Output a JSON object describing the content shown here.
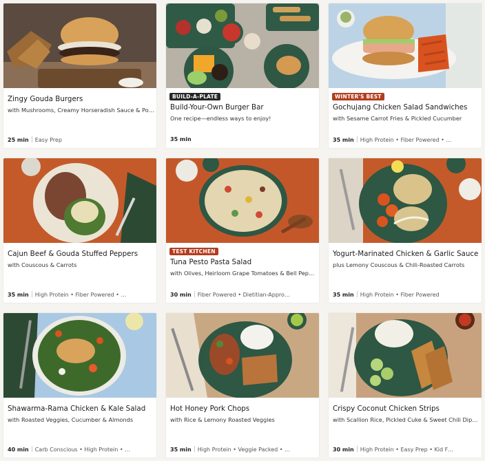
{
  "recipes": [
    {
      "title": "Zingy Gouda Burgers",
      "subtitle": "with Mushrooms, Creamy Horseradish Sauce & Potat…",
      "badge": "",
      "time": "25 min",
      "tags": "Easy Prep"
    },
    {
      "title": "Build-Your-Own Burger Bar",
      "subtitle": "One recipe—endless ways to enjoy!",
      "badge": "BUILD-A-PLATE",
      "badge_style": "dark",
      "time": "35 min",
      "tags": ""
    },
    {
      "title": "Gochujang Chicken Salad Sandwiches",
      "subtitle": "with Sesame Carrot Fries & Pickled Cucumber",
      "badge": "WINTER'S BEST",
      "badge_style": "rust",
      "time": "35 min",
      "tags": "High Protein • Fiber Powered • …"
    },
    {
      "title": "Cajun Beef & Gouda Stuffed Peppers",
      "subtitle": "with Couscous & Carrots",
      "badge": "",
      "time": "35 min",
      "tags": "High Protein • Fiber Powered • …"
    },
    {
      "title": "Tuna Pesto Pasta Salad",
      "subtitle": "with Olives, Heirloom Grape Tomatoes & Bell Pepper",
      "badge": "TEST KITCHEN",
      "badge_style": "rust",
      "time": "30 min",
      "tags": "Fiber Powered • Dietitian-Appro…"
    },
    {
      "title": "Yogurt-Marinated Chicken & Garlic Sauce",
      "subtitle": "plus Lemony Couscous & Chili-Roasted Carrots",
      "badge": "",
      "time": "35 min",
      "tags": "High Protein • Fiber Powered"
    },
    {
      "title": "Shawarma-Rama Chicken & Kale Salad",
      "subtitle": "with Roasted Veggies, Cucumber & Almonds",
      "badge": "",
      "time": "40 min",
      "tags": "Carb Conscious • High Protein • …"
    },
    {
      "title": "Hot Honey Pork Chops",
      "subtitle": "with Rice & Lemony Roasted Veggies",
      "badge": "",
      "time": "35 min",
      "tags": "High Protein • Veggie Packed • …"
    },
    {
      "title": "Crispy Coconut Chicken Strips",
      "subtitle": "with Scallion Rice, Pickled Cuke & Sweet Chili Dippi…",
      "badge": "",
      "time": "30 min",
      "tags": "High Protein • Easy Prep • Kid F…"
    }
  ],
  "photo_alts": [
    "burger-photo",
    "burger-bar-photo",
    "chicken-sandwich-photo",
    "stuffed-peppers-photo",
    "pasta-salad-photo",
    "yogurt-chicken-photo",
    "kale-salad-photo",
    "pork-chops-photo",
    "coconut-chicken-photo"
  ]
}
